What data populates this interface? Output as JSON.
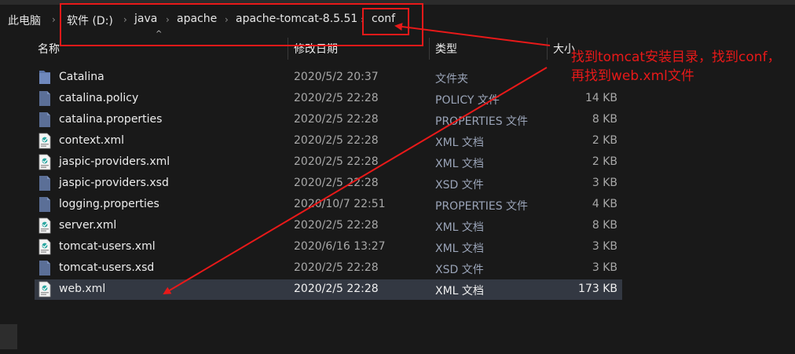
{
  "breadcrumb": {
    "items": [
      {
        "label": "此电脑"
      },
      {
        "label": "软件 (D:)"
      },
      {
        "label": "java"
      },
      {
        "label": "apache"
      },
      {
        "label": "apache-tomcat-8.5.51"
      },
      {
        "label": "conf"
      }
    ]
  },
  "columns": {
    "name": "名称",
    "date": "修改日期",
    "type": "类型",
    "size": "大小"
  },
  "files": [
    {
      "name": "Catalina",
      "date": "2020/5/2 20:37",
      "type": "文件夹",
      "size": "",
      "icon": "folder-icon"
    },
    {
      "name": "catalina.policy",
      "date": "2020/2/5 22:28",
      "type": "POLICY 文件",
      "size": "14 KB",
      "icon": "file-icon"
    },
    {
      "name": "catalina.properties",
      "date": "2020/2/5 22:28",
      "type": "PROPERTIES 文件",
      "size": "8 KB",
      "icon": "file-icon"
    },
    {
      "name": "context.xml",
      "date": "2020/2/5 22:28",
      "type": "XML 文档",
      "size": "2 KB",
      "icon": "xml-file-icon"
    },
    {
      "name": "jaspic-providers.xml",
      "date": "2020/2/5 22:28",
      "type": "XML 文档",
      "size": "2 KB",
      "icon": "xml-file-icon"
    },
    {
      "name": "jaspic-providers.xsd",
      "date": "2020/2/5 22:28",
      "type": "XSD 文件",
      "size": "3 KB",
      "icon": "file-icon"
    },
    {
      "name": "logging.properties",
      "date": "2020/10/7 22:51",
      "type": "PROPERTIES 文件",
      "size": "4 KB",
      "icon": "file-icon"
    },
    {
      "name": "server.xml",
      "date": "2020/2/5 22:28",
      "type": "XML 文档",
      "size": "8 KB",
      "icon": "xml-file-icon"
    },
    {
      "name": "tomcat-users.xml",
      "date": "2020/6/16 13:27",
      "type": "XML 文档",
      "size": "3 KB",
      "icon": "xml-file-icon"
    },
    {
      "name": "tomcat-users.xsd",
      "date": "2020/2/5 22:28",
      "type": "XSD 文件",
      "size": "3 KB",
      "icon": "file-icon"
    },
    {
      "name": "web.xml",
      "date": "2020/2/5 22:28",
      "type": "XML 文档",
      "size": "173 KB",
      "icon": "xml-file-icon",
      "selected": true
    }
  ],
  "annotation": {
    "line1": "找到tomcat安装目录，找到conf，",
    "line2": "再找到web.xml文件",
    "color": "#e81919"
  },
  "colors": {
    "background": "#191919",
    "selected_row": "#333842",
    "annotation_red": "#e81919"
  }
}
